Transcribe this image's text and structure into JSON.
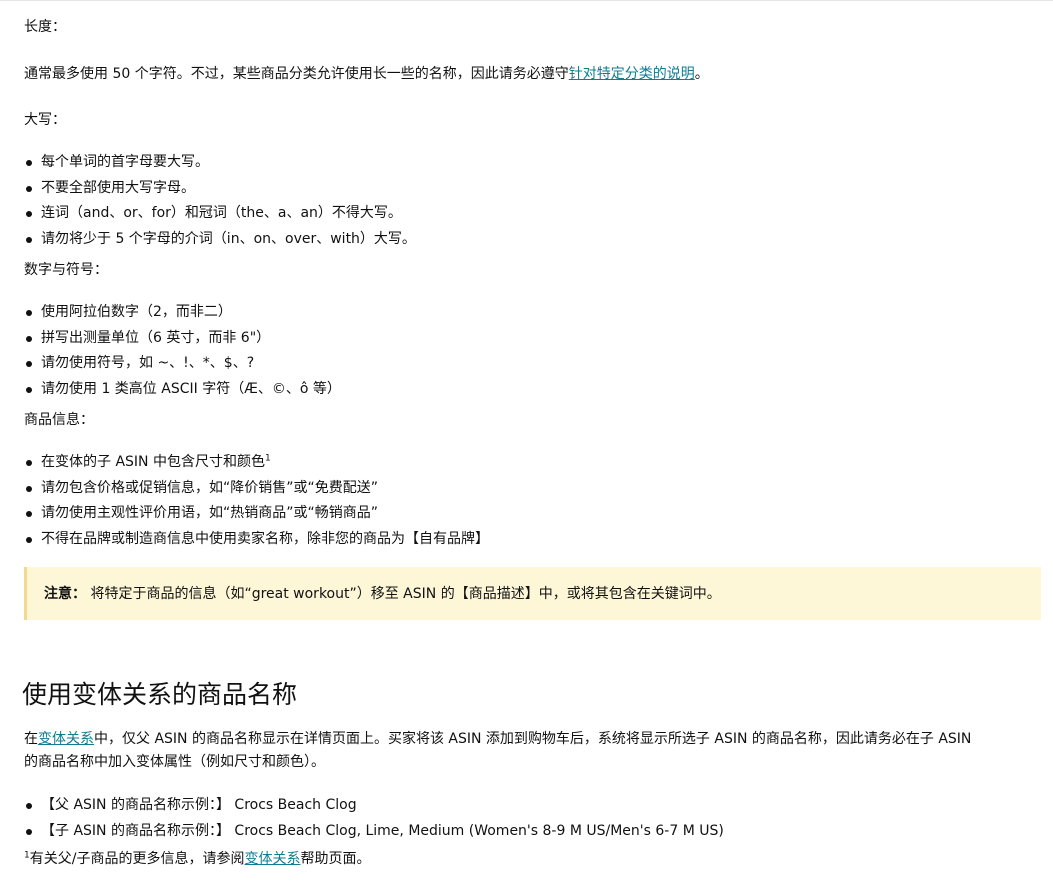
{
  "sections": {
    "length": {
      "heading": "长度：",
      "text_before_link": "通常最多使用 50 个字符。不过，某些商品分类允许使用长一些的名称，因此请务必遵守",
      "link": "针对特定分类的说明",
      "text_after_link": "。"
    },
    "capitalization": {
      "heading": "大写：",
      "items": [
        "每个单词的首字母要大写。",
        "不要全部使用大写字母。",
        "连词（and、or、for）和冠词（the、a、an）不得大写。",
        "请勿将少于 5 个字母的介词（in、on、over、with）大写。"
      ]
    },
    "numbers": {
      "heading": "数字与符号：",
      "items": [
        "使用阿拉伯数字（2，而非二）",
        "拼写出测量单位（6 英寸，而非 6\"）",
        "请勿使用符号，如 ~、!、*、$、?",
        "请勿使用 1 类高位 ASCII 字符（Æ、©、ô 等）"
      ]
    },
    "product_info": {
      "heading": "商品信息：",
      "item1_text": "在变体的子 ASIN 中包含尺寸和颜色",
      "item1_sup": "1",
      "items": [
        "请勿包含价格或促销信息，如“降价销售”或“免费配送”",
        "请勿使用主观性评价用语，如“热销商品”或“畅销商品”",
        "不得在品牌或制造商信息中使用卖家名称，除非您的商品为【自有品牌】"
      ]
    }
  },
  "note": {
    "label": "注意：",
    "text": " 将特定于商品的信息（如“great workout”）移至 ASIN 的【商品描述】中，或将其包含在关键词中。"
  },
  "variation": {
    "heading": "使用变体关系的商品名称",
    "para_prefix": "在",
    "para_link": "变体关系",
    "para_line1_rest": "中，仅父 ASIN 的商品名称显示在详情页面上。买家将该 ASIN 添加到购物车后，系统将显示所选子 ASIN 的商品名称，因此请务必在子 ASIN",
    "para_line2": "的商品名称中加入变体属性（例如尺寸和颜色）。",
    "examples": [
      {
        "label": "【父 ASIN 的商品名称示例：】",
        "value": " Crocs Beach Clog"
      },
      {
        "label": "【子 ASIN 的商品名称示例：】",
        "value": " Crocs Beach Clog, Lime, Medium (Women's 8-9 M US/Men's 6-7 M US)"
      }
    ],
    "footnote_sup": "1",
    "footnote_text": "有关父/子商品的更多信息，请参阅",
    "footnote_link": "变体关系",
    "footnote_after": "帮助页面。"
  }
}
